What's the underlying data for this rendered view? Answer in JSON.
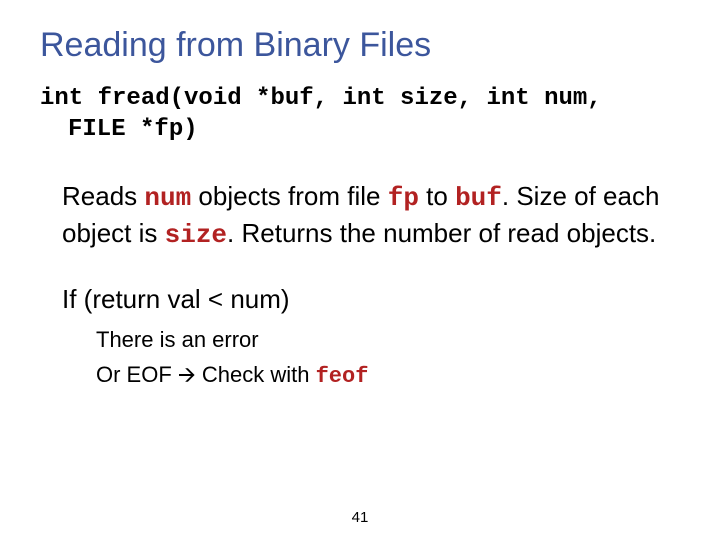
{
  "title": "Reading from Binary Files",
  "prototype": {
    "line1": "int fread(void *buf, int size, int num,",
    "line2": "FILE *fp)"
  },
  "bullets": {
    "b1": {
      "pre": "Reads ",
      "num": "num",
      "mid1": " objects from file ",
      "fp": "fp",
      "mid2": " to ",
      "buf": "buf",
      "post1": ". Size of each object is ",
      "size": "size",
      "post2": ". Returns the number of read objects."
    },
    "b2": "If (return val < num)",
    "sub1": "There is an error",
    "sub2": {
      "pre": "Or EOF ",
      "arrow": "🡪",
      "mid": " Check with ",
      "feof": "feof"
    }
  },
  "page": "41"
}
